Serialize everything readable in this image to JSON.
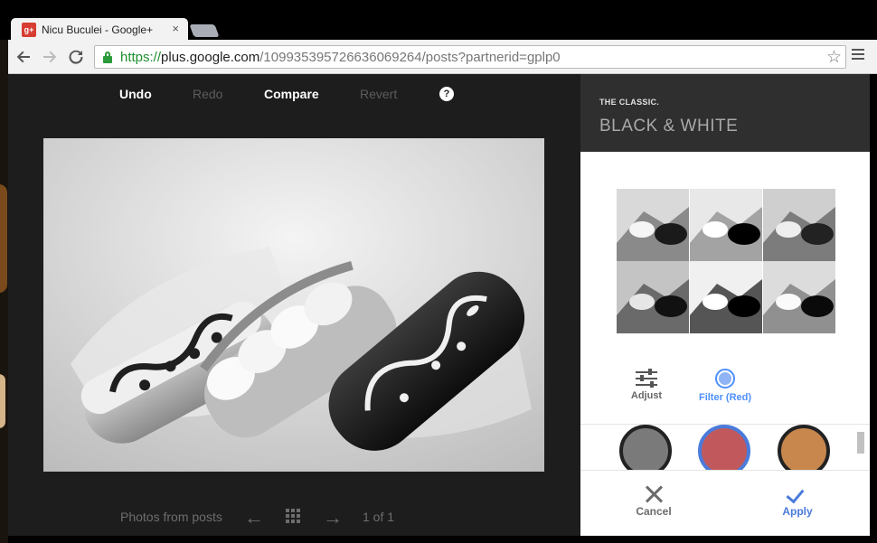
{
  "browser": {
    "tab_title": "Nicu Buculei - Google+",
    "tab_favicon": "g+",
    "tab_close": "×",
    "url_scheme": "https://",
    "url_host": "plus.google.com",
    "url_path": "/109935395726636069264/posts?partnerid=gplp0",
    "star": "☆"
  },
  "editor": {
    "undo": "Undo",
    "redo": "Redo",
    "compare": "Compare",
    "revert": "Revert",
    "help": "?",
    "footer_label": "Photos from posts",
    "prev_arrow": "←",
    "next_arrow": "→",
    "counter": "1 of 1"
  },
  "panel": {
    "kicker": "THE CLASSIC.",
    "title": "BLACK & WHITE",
    "thumbnails": 6,
    "modes": [
      {
        "label": "Adjust",
        "icon": "sliders-icon"
      },
      {
        "label": "Filter (Red)",
        "icon": "filter-icon"
      }
    ],
    "swatches": [
      {
        "name": "gray",
        "color": "#7a7a7a"
      },
      {
        "name": "red",
        "color": "#c1595c"
      },
      {
        "name": "orange",
        "color": "#c8874d"
      }
    ],
    "cancel": "Cancel",
    "apply": "Apply"
  },
  "colors": {
    "accent": "#4a7bdb",
    "editor_bg": "#1d1d1d",
    "panel_header_bg": "#2f2f2f"
  }
}
